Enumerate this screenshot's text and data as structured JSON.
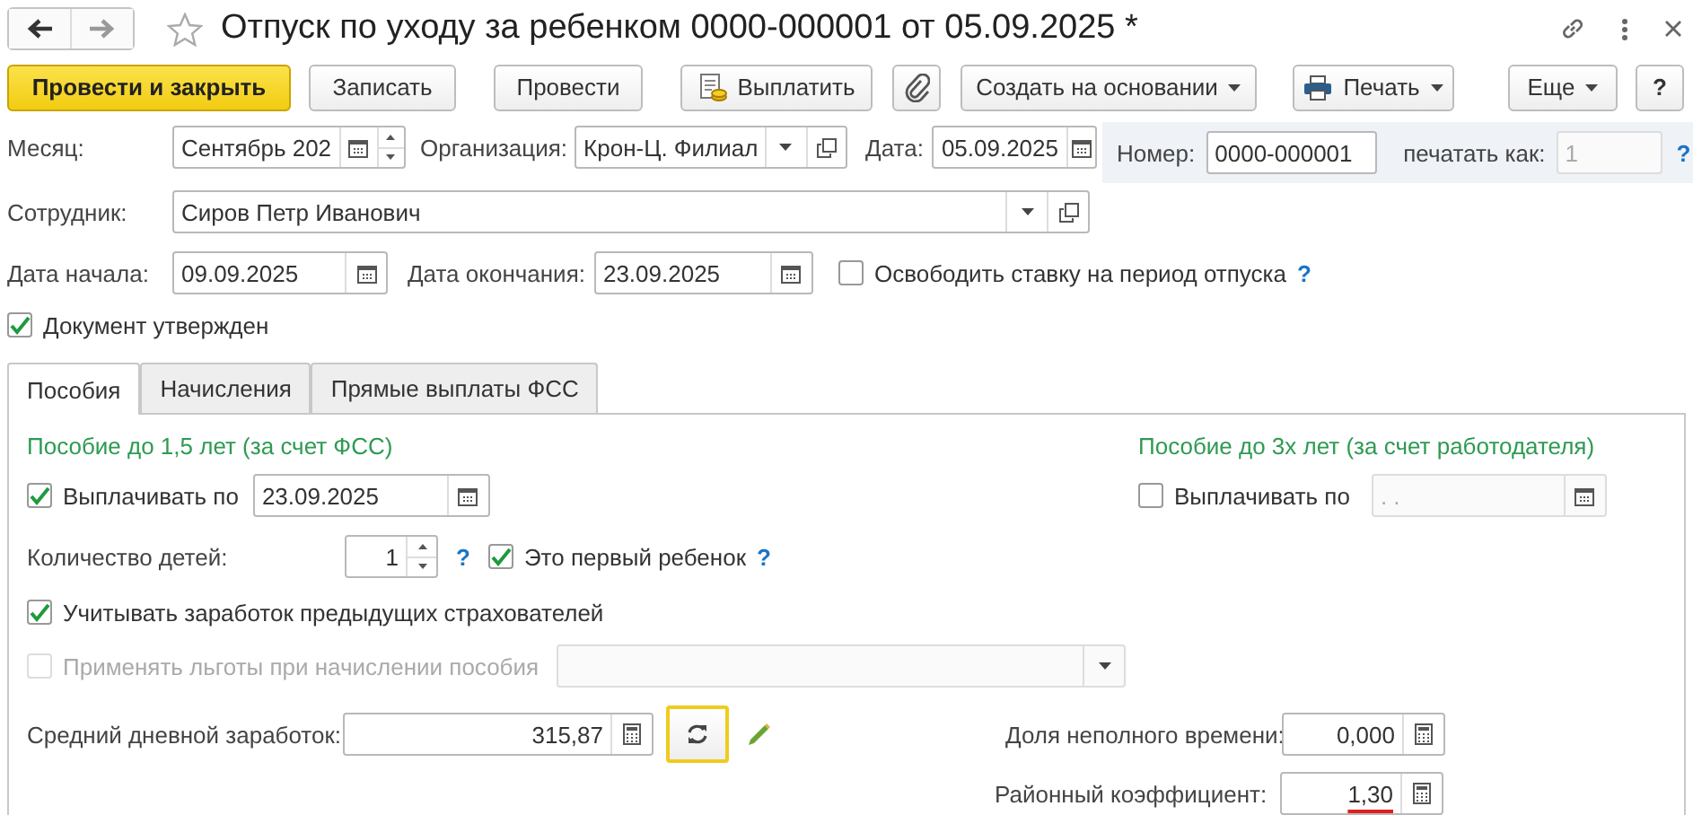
{
  "window": {
    "title": "Отпуск по уходу за ребенком 0000-000001 от 05.09.2025 *"
  },
  "toolbar": [
    {
      "kind": "primary",
      "label": "Провести и закрыть"
    },
    {
      "kind": "plain",
      "label": "Записать"
    },
    {
      "kind": "plain",
      "label": "Провести"
    },
    {
      "kind": "pay",
      "label": "Выплатить"
    },
    {
      "kind": "attach"
    },
    {
      "kind": "menu",
      "label": "Создать на основании"
    },
    {
      "kind": "print",
      "label": "Печать"
    },
    {
      "kind": "menu",
      "label": "Еще"
    },
    {
      "kind": "help",
      "label": "?"
    }
  ],
  "header": {
    "month": {
      "label": "Месяц:",
      "value": "Сентябрь 202"
    },
    "organization": {
      "label": "Организация:",
      "value": "Крон-Ц. Филиал"
    },
    "date": {
      "label": "Дата:",
      "value": "05.09.2025"
    },
    "number": {
      "label": "Номер:",
      "value": "0000-000001"
    },
    "print_as": {
      "label": "печатать как:",
      "value": "1",
      "disabled": true
    },
    "help": "?"
  },
  "employee": {
    "label": "Сотрудник:",
    "value": "Сиров Петр Иванович"
  },
  "start_date": {
    "label": "Дата начала:",
    "value": "09.09.2025"
  },
  "end_date": {
    "label": "Дата окончания:",
    "value": "23.09.2025"
  },
  "free_rate": {
    "label": "Освободить ставку на период отпуска",
    "checked": false,
    "help": "?"
  },
  "approved": {
    "label": "Документ утвержден",
    "checked": true
  },
  "tabs": [
    {
      "label": "Пособия",
      "selected": true
    },
    {
      "label": "Начисления",
      "selected": false
    },
    {
      "label": "Прямые выплаты ФСС",
      "selected": false
    }
  ],
  "benefit_1_5": {
    "title": "Пособие до 1,5 лет (за счет ФСС)",
    "pay_until": {
      "label": "Выплачивать по",
      "checked": true,
      "value": "23.09.2025"
    },
    "children_count": {
      "label": "Количество детей:",
      "value": "1",
      "help": "?"
    },
    "first_child": {
      "label": "Это первый ребенок",
      "checked": true,
      "help": "?"
    },
    "prior_earnings": {
      "label": "Учитывать заработок предыдущих страхователей",
      "checked": true
    },
    "apply_benefits": {
      "label": "Применять льготы при начислении пособия",
      "checked": false,
      "disabled": true
    },
    "average_daily": {
      "label": "Средний дневной заработок:",
      "value": "315,87"
    }
  },
  "benefit_3": {
    "title": "Пособие до 3х лет (за счет работодателя)",
    "pay_until": {
      "label": "Выплачивать по",
      "checked": false,
      "placeholder": ".  .",
      "disabled": true
    }
  },
  "part_time_share": {
    "label": "Доля неполного времени:",
    "value": "0,000"
  },
  "regional_coefficient": {
    "label": "Районный коэффициент:",
    "value": "1,30",
    "flagged": true
  }
}
